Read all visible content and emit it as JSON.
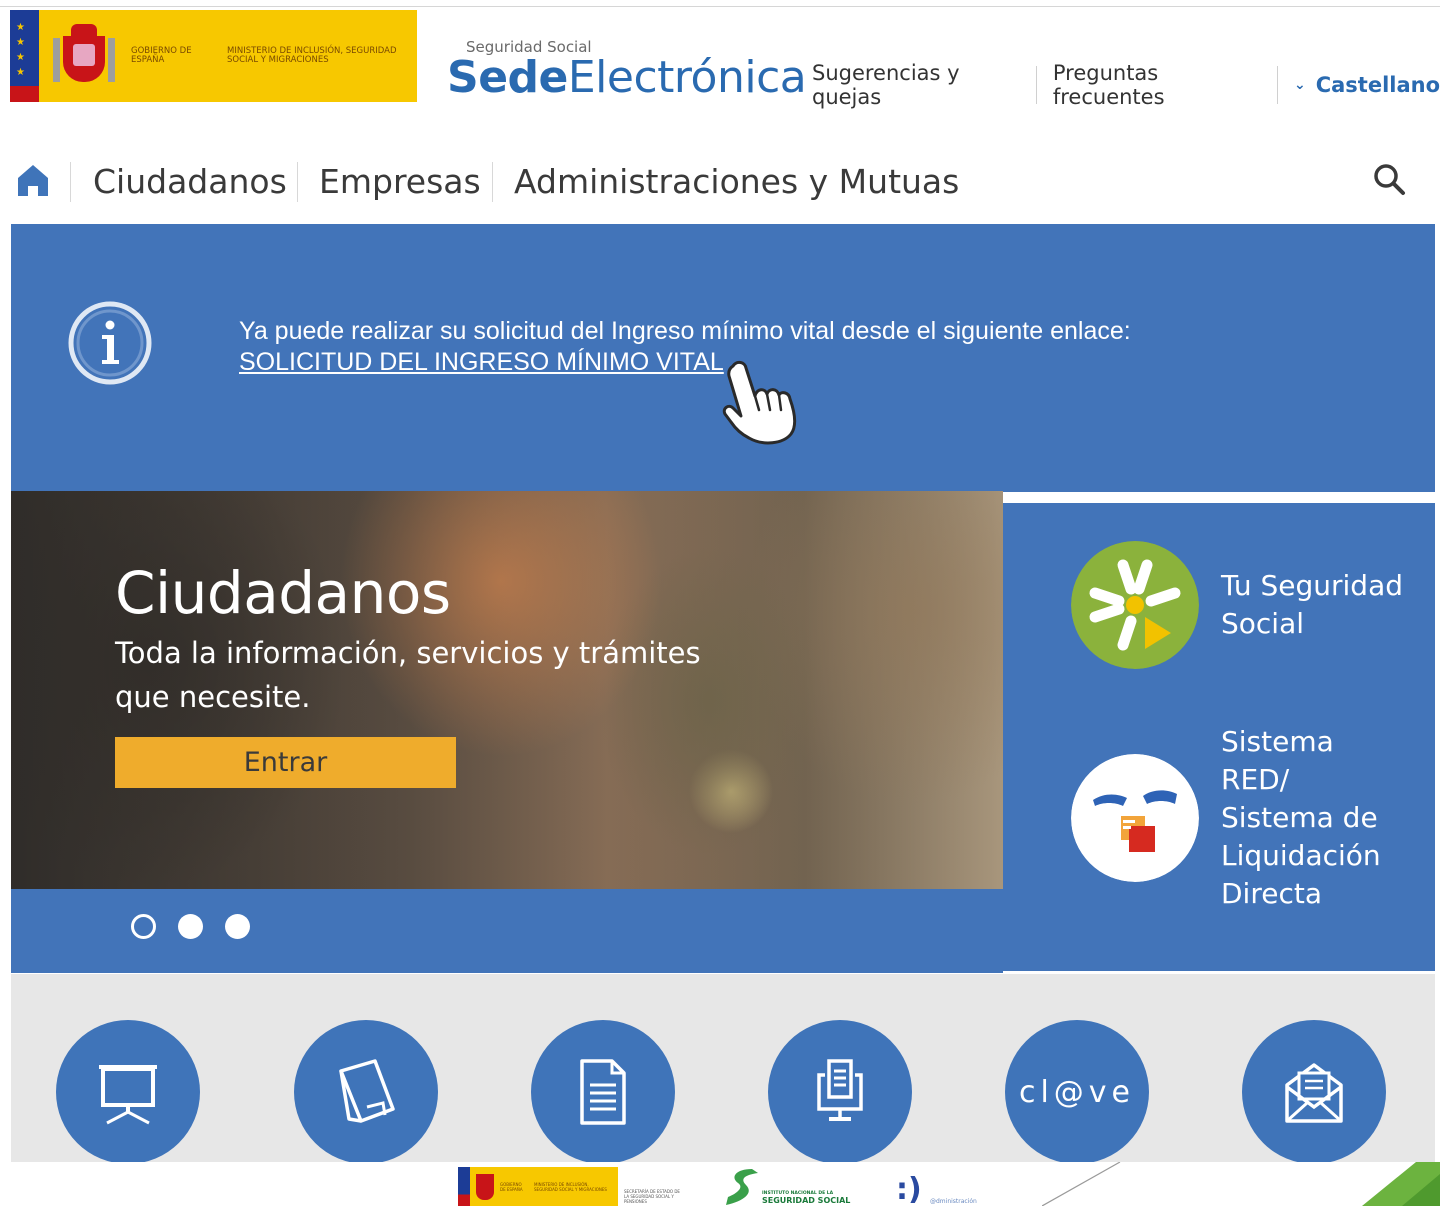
{
  "header": {
    "gov_logo": {
      "gobierno": "GOBIERNO DE ESPAÑA",
      "ministerio": "MINISTERIO DE INCLUSIÓN, SEGURIDAD SOCIAL Y MIGRACIONES"
    },
    "sede_subtitle": "Seguridad Social",
    "sede_title_bold": "Sede",
    "sede_title_light": "Electrónica",
    "links": {
      "suggestions": "Sugerencias y quejas",
      "faq": "Preguntas frecuentes",
      "language": "Castellano"
    }
  },
  "nav": {
    "items": [
      "Ciudadanos",
      "Empresas",
      "Administraciones y Mutuas"
    ]
  },
  "alert": {
    "message": "Ya puede realizar su solicitud del Ingreso mínimo vital desde el siguiente enlace:",
    "link_text": "SOLICITUD DEL INGRESO MÍNIMO VITAL"
  },
  "carousel": {
    "title": "Ciudadanos",
    "description": "Toda la información, servicios y trámites que necesite.",
    "button_label": "Entrar",
    "slide_count": 3,
    "active_slide": 1
  },
  "side_panel": {
    "items": [
      {
        "label": "Tu Seguridad Social",
        "icon": "tu-seguridad-social-logo-icon"
      },
      {
        "label": "Sistema RED/ Sistema de Liquidación Directa",
        "icon": "sistema-red-logo-icon"
      }
    ]
  },
  "services": {
    "items": [
      {
        "icon": "presentation-board-icon"
      },
      {
        "icon": "folder-icon"
      },
      {
        "icon": "document-icon"
      },
      {
        "icon": "computer-document-icon"
      },
      {
        "icon": "clave-logo-icon",
        "text": "cl@ve"
      },
      {
        "icon": "envelope-icon"
      }
    ]
  },
  "footer": {
    "gov_logo": {
      "gobierno": "GOBIERNO DE ESPAÑA",
      "ministerio": "MINISTERIO DE INCLUSIÓN, SEGURIDAD SOCIAL Y MIGRACIONES",
      "secretaria": "SECRETARÍA DE ESTADO DE LA SEGURIDAD SOCIAL Y PENSIONES"
    },
    "inss": {
      "line1": "INSTITUTO NACIONAL DE LA",
      "line2": "SEGURIDAD SOCIAL"
    },
    "administracion_digital": ":)",
    "administracion_text": "@dministración"
  },
  "colors": {
    "brand_blue": "#4274b9",
    "title_blue": "#2a6ab0",
    "button_amber": "#efac2c",
    "services_bg": "#e7e7e7",
    "tss_green": "#8bb23c"
  }
}
